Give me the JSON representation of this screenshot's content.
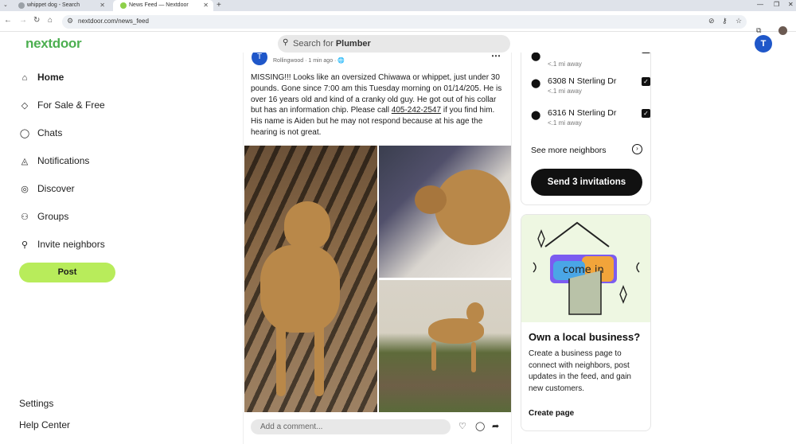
{
  "browser": {
    "tabs": [
      {
        "title": "whippet dog - Search",
        "favicon_color": "#5f6368"
      },
      {
        "title": "News Feed — Nextdoor",
        "favicon_color": "#8ed04a"
      }
    ],
    "url": "nextdoor.com/news_feed"
  },
  "header": {
    "brand": "nextdoor",
    "search_placeholder_prefix": "Search for ",
    "search_placeholder_term": "Plumber",
    "user_initial": "T"
  },
  "sidebar": {
    "items": [
      {
        "label": "Home",
        "icon": "home-icon",
        "glyph": "⌂"
      },
      {
        "label": "For Sale & Free",
        "icon": "tag-icon",
        "glyph": "◇"
      },
      {
        "label": "Chats",
        "icon": "chat-icon",
        "glyph": "◯"
      },
      {
        "label": "Notifications",
        "icon": "bell-icon",
        "glyph": "◬"
      },
      {
        "label": "Discover",
        "icon": "compass-icon",
        "glyph": "◎"
      },
      {
        "label": "Groups",
        "icon": "groups-icon",
        "glyph": "⚇"
      },
      {
        "label": "Invite neighbors",
        "icon": "invite-icon",
        "glyph": "⚲"
      }
    ],
    "post_label": "Post",
    "settings_label": "Settings",
    "help_label": "Help Center"
  },
  "post": {
    "author_initial": "T",
    "meta": "Rollingwood · 1 min ago · 🌐",
    "text_before_phone": "MISSING!!! Looks like an oversized Chiwawa or whippet, just under 30 pounds. Gone since 7:00 am this Tuesday morning on 01/14/205. He is over 16 years old and kind of a cranky old guy. He got out of his collar but has an information chip. Please call ",
    "phone": "405-242-2547",
    "text_after_phone": " if you find him. His name is Aiden but he may not respond because at his age the hearing is not great.",
    "comment_placeholder": "Add a comment..."
  },
  "neighbors": {
    "partial_top_dist": "<.1 mi away",
    "items": [
      {
        "address": "6308 N Sterling Dr",
        "distance": "<.1 mi away",
        "checked": true
      },
      {
        "address": "6316 N Sterling Dr",
        "distance": "<.1 mi away",
        "checked": true
      }
    ],
    "see_more_label": "See more neighbors",
    "send_label": "Send 3 invitations"
  },
  "business": {
    "title": "Own a local business?",
    "body": "Create a business page to connect with neighbors, post updates in the feed, and gain new customers.",
    "cta": "Create page"
  }
}
